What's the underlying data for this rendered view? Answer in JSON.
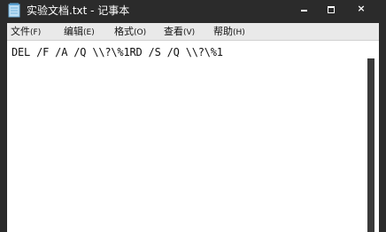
{
  "window": {
    "title": "实验文档.txt - 记事本",
    "controls": {
      "minimize_icon": "minimize-icon",
      "maximize_icon": "maximize-icon",
      "close_label": "×"
    }
  },
  "menu": {
    "items": [
      {
        "label": "文件",
        "accel": "(F)"
      },
      {
        "label": "编辑",
        "accel": "(E)"
      },
      {
        "label": "格式",
        "accel": "(O)"
      },
      {
        "label": "查看",
        "accel": "(V)"
      },
      {
        "label": "帮助",
        "accel": "(H)"
      }
    ]
  },
  "editor": {
    "content": "DEL /F /A /Q \\\\?\\%1RD /S /Q \\\\?\\%1"
  },
  "colors": {
    "titlebar": "#2b2b2b",
    "menubar": "#e9e9e9",
    "editor_bg": "#ffffff"
  }
}
